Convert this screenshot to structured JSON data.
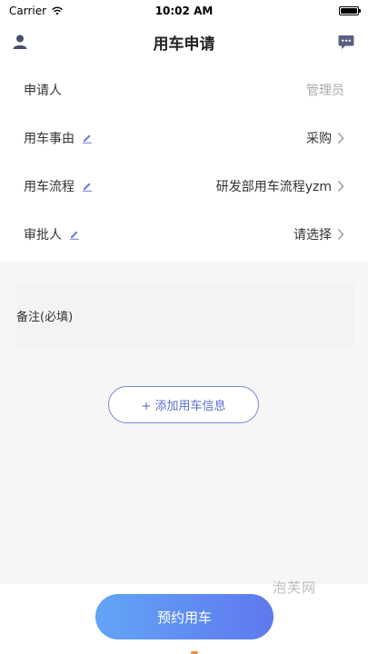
{
  "status_bar": {
    "carrier": "Carrier",
    "time": "10:02 AM",
    "battery_level": 1.0
  },
  "nav": {
    "title": "用车申请",
    "left_icon": "user-icon",
    "right_icon": "message-icon"
  },
  "form": {
    "applicant": {
      "label": "申请人",
      "value": "管理员"
    },
    "reason": {
      "label": "用车事由",
      "value": "采购"
    },
    "flow": {
      "label": "用车流程",
      "value": "研发部用车流程yzm"
    },
    "approver": {
      "label": "审批人",
      "value": "请选择"
    }
  },
  "note": {
    "placeholder": "备注(必填)"
  },
  "add_vehicle": {
    "label": "+ 添加用车信息"
  },
  "submit": {
    "label": "预约用车"
  },
  "watermark": "泡芙网",
  "colors": {
    "accent": "#5f78ee",
    "accent_light": "#62a5f7",
    "edit_icon": "#6b7bd6"
  }
}
